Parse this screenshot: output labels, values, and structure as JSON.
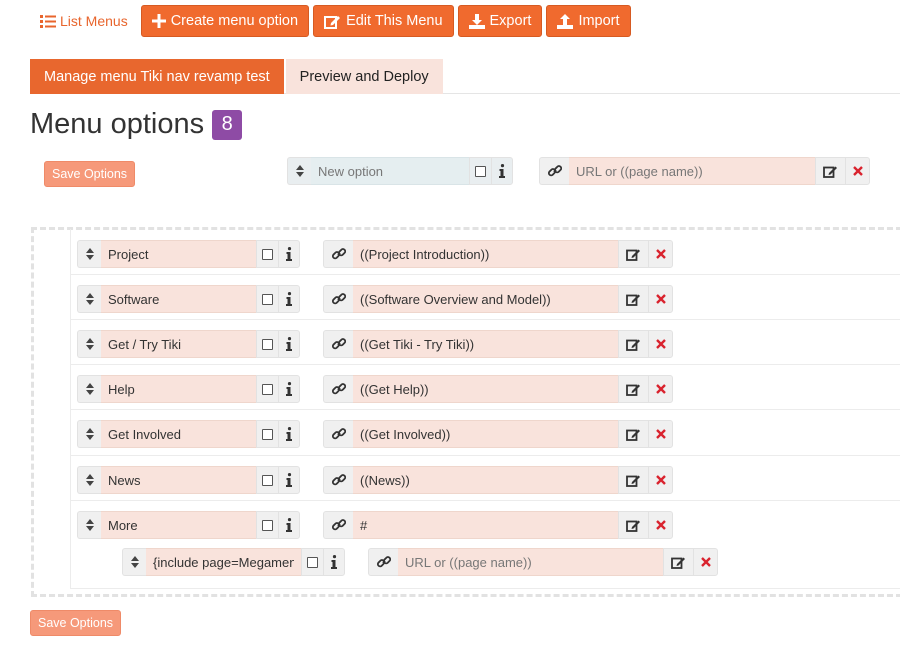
{
  "toolbar": {
    "list_menus": "List Menus",
    "create": "Create menu option",
    "edit": "Edit This Menu",
    "export": "Export",
    "import": "Import"
  },
  "tabs": [
    {
      "label": "Manage menu Tiki nav revamp test",
      "active": true
    },
    {
      "label": "Preview and Deploy",
      "active": false
    }
  ],
  "heading": {
    "title": "Menu options",
    "count": "8"
  },
  "save_label": "Save Options",
  "new_option": {
    "name_placeholder": "New option",
    "url_placeholder": "URL or ((page name))"
  },
  "options": [
    {
      "name": "Project",
      "url": "((Project Introduction))"
    },
    {
      "name": "Software",
      "url": "((Software Overview and Model))"
    },
    {
      "name": "Get / Try Tiki",
      "url": "((Get Tiki - Try Tiki))"
    },
    {
      "name": "Help",
      "url": "((Get Help))"
    },
    {
      "name": "Get Involved",
      "url": "((Get Involved))"
    },
    {
      "name": "News",
      "url": "((News))"
    },
    {
      "name": "More",
      "url": "#"
    }
  ],
  "child_option": {
    "name": "{include page=Megamenu_",
    "url_placeholder": "URL or ((page name))"
  },
  "colors": {
    "accent": "#f06a2e",
    "badge": "#8e4ba5",
    "field": "#f9e3dc",
    "delete": "#d9232e"
  }
}
